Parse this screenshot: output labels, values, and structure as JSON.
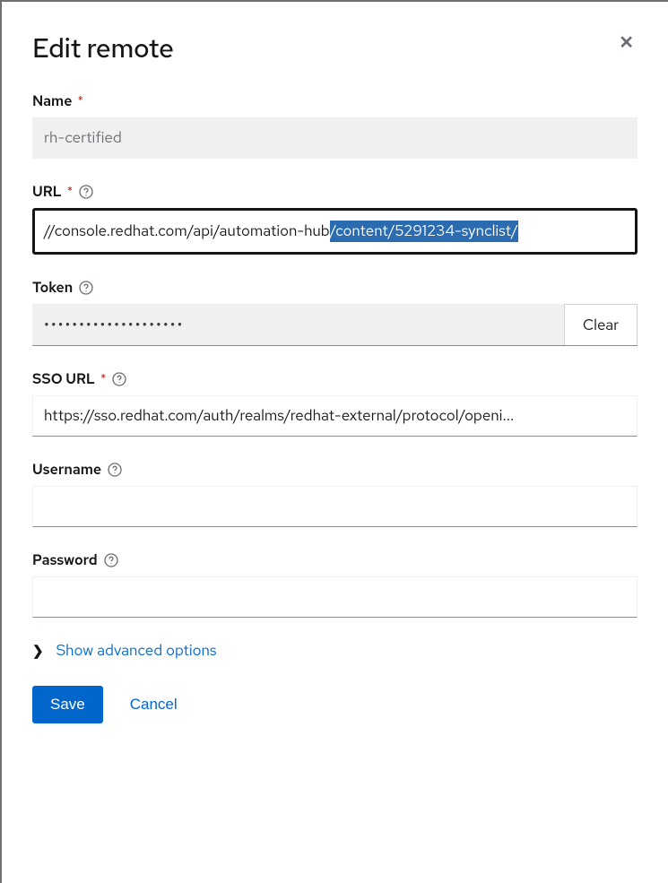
{
  "dialog": {
    "title": "Edit remote",
    "close_aria": "Close"
  },
  "fields": {
    "name": {
      "label": "Name",
      "required": true,
      "value": "rh-certified"
    },
    "url": {
      "label": "URL",
      "required": true,
      "has_help": true,
      "value_plain": "//console.redhat.com/api/automation-hub",
      "value_selected": "/content/5291234-synclist/"
    },
    "token": {
      "label": "Token",
      "has_help": true,
      "masked_value": "••••••••••••••••••••",
      "clear_label": "Clear"
    },
    "sso_url": {
      "label": "SSO URL",
      "required": true,
      "has_help": true,
      "value": "https://sso.redhat.com/auth/realms/redhat-external/protocol/openi..."
    },
    "username": {
      "label": "Username",
      "has_help": true,
      "value": ""
    },
    "password": {
      "label": "Password",
      "has_help": true,
      "value": ""
    }
  },
  "advanced": {
    "toggle_label": "Show advanced options"
  },
  "actions": {
    "save": "Save",
    "cancel": "Cancel"
  }
}
